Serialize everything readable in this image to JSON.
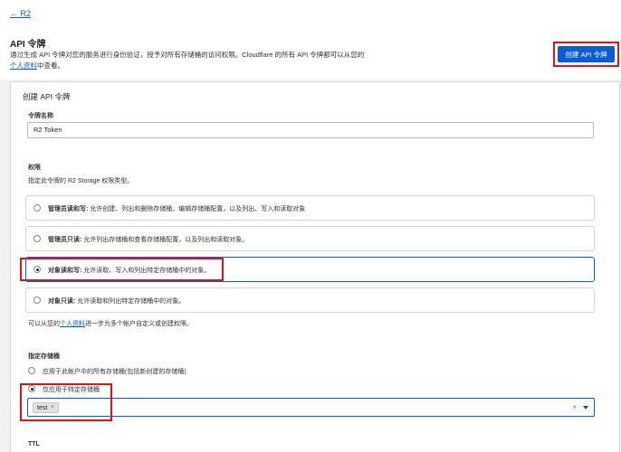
{
  "header": {
    "back_link": "← R2",
    "title": "API 令牌",
    "description_prefix": "通过生成 API 令牌对您的服务进行身份验证，授予对所有存储桶的访问权限。Cloudflare 的所有 API 令牌都可以从您的",
    "profile_link": "个人资料",
    "description_suffix": "中查看。",
    "create_button": "创建 API 令牌"
  },
  "form": {
    "section_title": "创建 API 令牌",
    "token_name_label": "令牌名称",
    "token_name_value": "R2 Token",
    "permissions_label": "权限",
    "permissions_help": "指定此令牌的 R2 Storage 权限类型。",
    "permissions": [
      {
        "title": "管理员读和写:",
        "desc": " 允许创建、列出和删除存储桶，编辑存储桶配置，以及列出、写入和读取对象",
        "selected": false
      },
      {
        "title": "管理员只读:",
        "desc": " 允许列出存储桶和查看存储桶配置，以及列出和读取对象。",
        "selected": false
      },
      {
        "title": "对象读和写:",
        "desc": " 允许读取、写入和列出特定存储桶中的对象。",
        "selected": true
      },
      {
        "title": "对象只读:",
        "desc": " 允许读取和列出特定存储桶中的对象。",
        "selected": false
      }
    ],
    "permissions_footer_prefix": "可以从您的",
    "permissions_footer_link": "个人资料",
    "permissions_footer_suffix": "进一步为多个帐户自定义或创建权限。",
    "bucket_label": "指定存储桶",
    "bucket_options": [
      {
        "label": "应用于此帐户中的所有存储桶(包括新创建的存储桶)",
        "selected": false
      },
      {
        "label": "仅应用于特定存储桶",
        "selected": true
      }
    ],
    "selected_bucket_tag": "test",
    "ttl_label": "TTL"
  },
  "colors": {
    "accent": "#0a5bd8",
    "highlight": "#e8101a"
  },
  "icons": {
    "tag_remove": "×",
    "clear": "×",
    "dropdown": "caret-down"
  }
}
